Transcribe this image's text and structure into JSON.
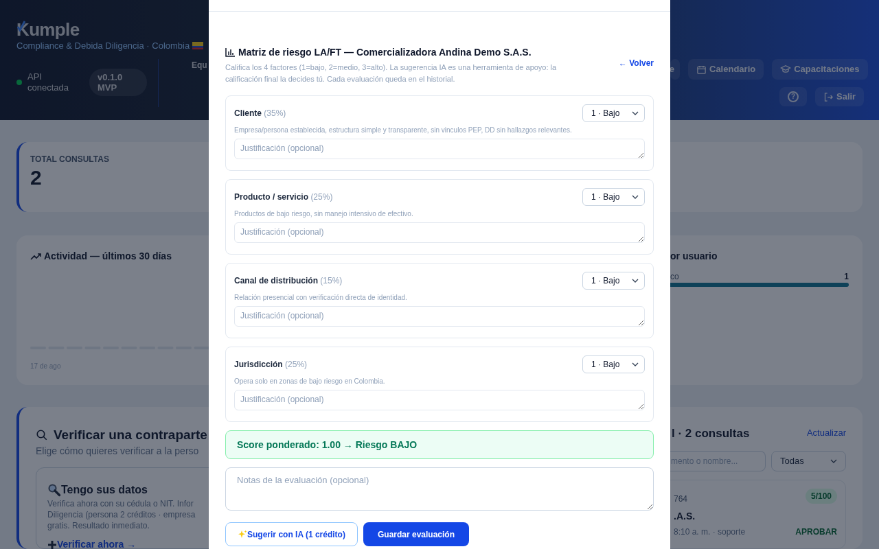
{
  "header": {
    "logo": "Kumple",
    "subtitle": "Compliance & Debida Diligencia · Colombia",
    "api_status": {
      "label": "API conectada",
      "connected": true
    },
    "version_badge": "v0.1.0 MVP",
    "nav_cut": "Equ",
    "nav_buttons": [
      {
        "label": "e",
        "kind": "cut"
      },
      {
        "label": "Calendario",
        "kind": "calendar"
      },
      {
        "label": "Capacitaciones",
        "kind": "cap"
      }
    ],
    "help_button": "?",
    "logout_button": "Salir"
  },
  "stats": {
    "label": "TOTAL CONSULTAS",
    "value": "2"
  },
  "activity": {
    "title": "Actividad — últimos 30 días",
    "axis_label": "17 de ago"
  },
  "by_user": {
    "title": "or usuario",
    "rows": [
      {
        "label": "co",
        "value": "1",
        "level": 1
      }
    ]
  },
  "verify": {
    "title": "Verificar una contraparte",
    "subtitle": "Elige cómo quieres verificar a la perso",
    "option": {
      "title": "Tengo sus datos",
      "lines": [
        "Verifica ahora con su cédula o NIT. Infor",
        "Diligencia (persona 2 créditos · empresa",
        "gratis. Resultado inmediato."
      ],
      "link": "Verificar ahora →"
    }
  },
  "history": {
    "title": "l · 2 consultas",
    "refresh": "Actualizar",
    "search_placeholder": "mento o nombre...",
    "filter": "Todas",
    "item": {
      "id": "764",
      "score": "5/100",
      "name": ".A.S.",
      "meta": "8:10 a. m. · soporte",
      "decision": "APROBAR"
    }
  },
  "modal": {
    "title": "Matriz de riesgo LA/FT — Comercializadora Andina Demo S.A.S.",
    "subtitle": "Califica los 4 factores (1=bajo, 2=medio, 3=alto). La sugerencia IA es una herramienta de apoyo: la calificación final la decides tú. Cada evaluación queda en el historial.",
    "back": "← Volver",
    "factors": [
      {
        "name": "Cliente",
        "weight": "(35%)",
        "rating": "1 · Bajo",
        "description": "Empresa/persona establecida, estructura simple y transparente, sin vinculos PEP, DD sin hallazgos relevantes.",
        "placeholder": "Justificación (opcional)"
      },
      {
        "name": "Producto / servicio",
        "weight": "(25%)",
        "rating": "1 · Bajo",
        "description": "Productos de bajo riesgo, sin manejo intensivo de efectivo.",
        "placeholder": "Justificación (opcional)"
      },
      {
        "name": "Canal de distribución",
        "weight": "(15%)",
        "rating": "1 · Bajo",
        "description": "Relación presencial con verificación directa de identidad.",
        "placeholder": "Justificación (opcional)"
      },
      {
        "name": "Jurisdicción",
        "weight": "(25%)",
        "rating": "1 · Bajo",
        "description": "Opera solo en zonas de bajo riesgo en Colombia.",
        "placeholder": "Justificación (opcional)"
      }
    ],
    "score": {
      "text": "Score ponderado: 1.00 → Riesgo BAJO"
    },
    "notes_placeholder": "Notas de la evaluación (opcional)",
    "suggest_button": "Sugerir con IA (1 crédito)",
    "save_button": "Guardar evaluación"
  }
}
